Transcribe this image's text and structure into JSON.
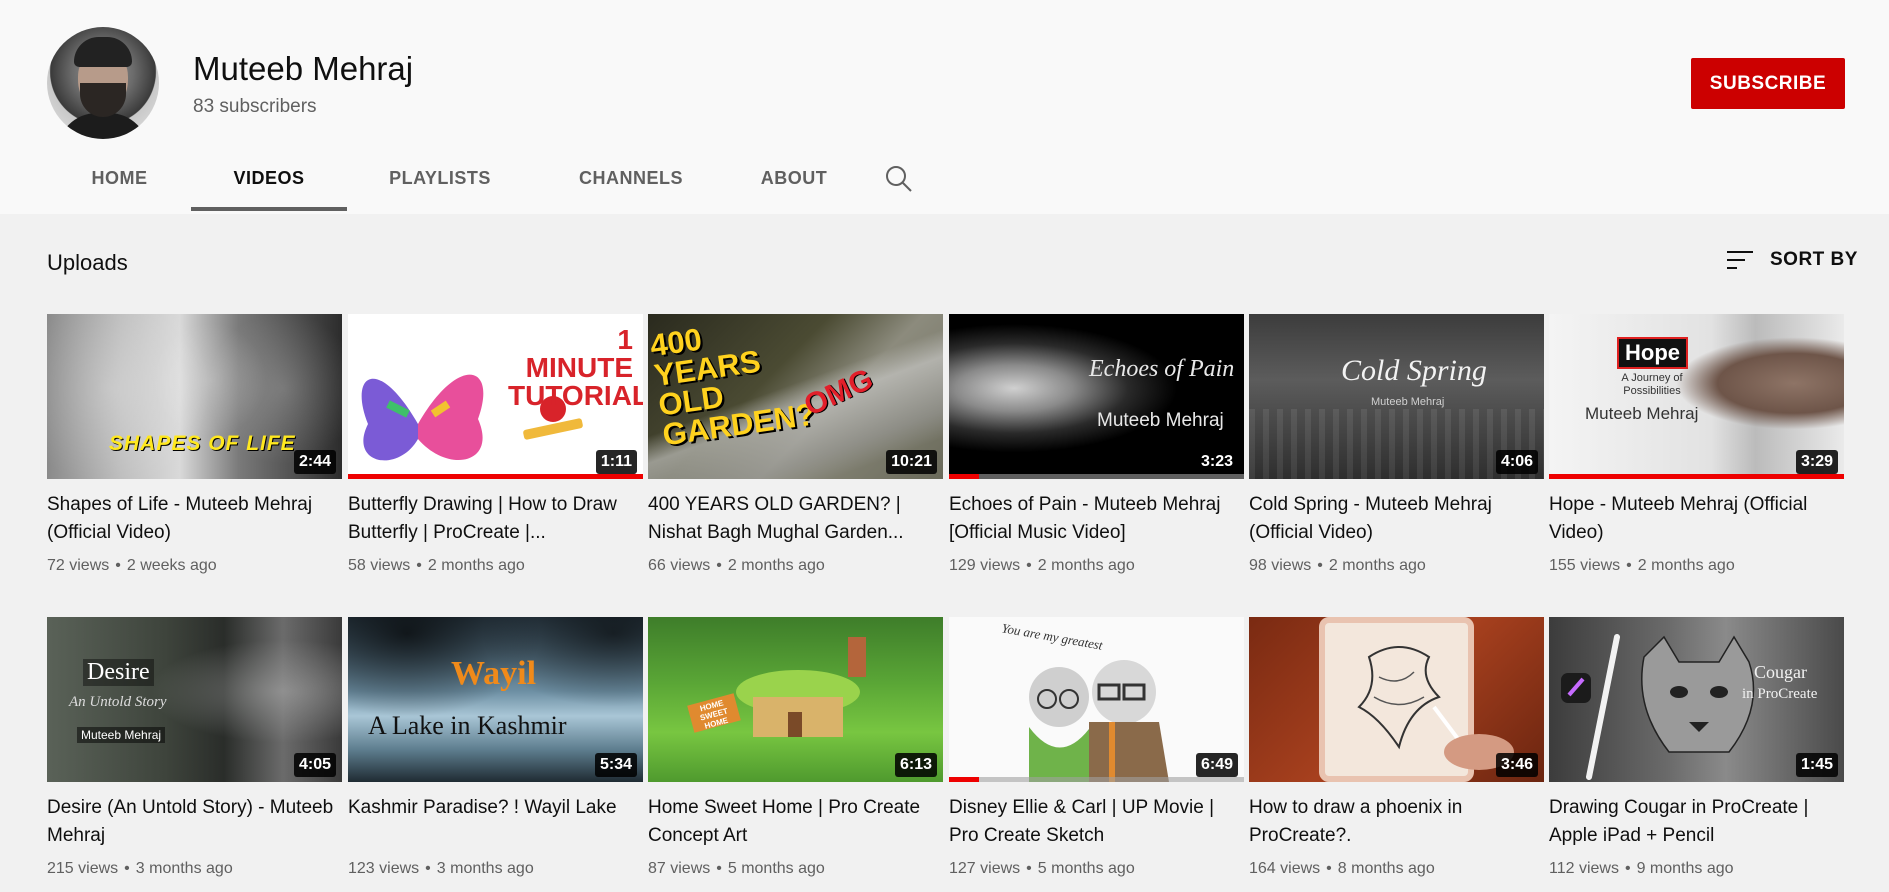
{
  "channel": {
    "name": "Muteeb Mehraj",
    "subscribers": "83 subscribers",
    "subscribe_label": "SUBSCRIBE"
  },
  "tabs": [
    {
      "label": "HOME"
    },
    {
      "label": "VIDEOS",
      "active": true
    },
    {
      "label": "PLAYLISTS"
    },
    {
      "label": "CHANNELS"
    },
    {
      "label": "ABOUT"
    }
  ],
  "search_icon": "search-icon",
  "section": {
    "title": "Uploads",
    "sort_label": "SORT BY",
    "sort_icon": "sort-icon"
  },
  "videos": [
    {
      "title": "Shapes of Life - Muteeb Mehraj (Official Video)",
      "views": "72 views",
      "age": "2 weeks ago",
      "duration": "2:44",
      "thumb_text": "SHAPES OF LIFE"
    },
    {
      "title": "Butterfly Drawing | How to Draw Butterfly | ProCreate |...",
      "views": "58 views",
      "age": "2 months ago",
      "duration": "1:11",
      "thumb_text": "1 MINUTE TUTORIAL",
      "progress": 1.0
    },
    {
      "title": "400 YEARS OLD GARDEN? | Nishat Bagh Mughal Garden...",
      "views": "66 views",
      "age": "2 months ago",
      "duration": "10:21",
      "thumb_text": "400 YEARS OLD GARDEN?",
      "thumb_text2": "OMG"
    },
    {
      "title": "Echoes of Pain - Muteeb Mehraj [Official Music Video]",
      "views": "129 views",
      "age": "2 months ago",
      "duration": "3:23",
      "thumb_text": "Echoes of Pain",
      "thumb_text2": "Muteeb Mehraj",
      "progress": 0.1
    },
    {
      "title": "Cold Spring - Muteeb Mehraj (Official Video)",
      "views": "98 views",
      "age": "2 months ago",
      "duration": "4:06",
      "thumb_text": "Cold Spring",
      "thumb_text2": "Muteeb Mehraj"
    },
    {
      "title": "Hope - Muteeb Mehraj (Official Video)",
      "views": "155 views",
      "age": "2 months ago",
      "duration": "3:29",
      "thumb_text": "Hope",
      "thumb_text2": "A Journey of Possibilities",
      "thumb_text3": "Muteeb Mehraj",
      "progress": 1.0
    },
    {
      "title": "Desire (An Untold Story) - Muteeb Mehraj",
      "views": "215 views",
      "age": "3 months ago",
      "duration": "4:05",
      "thumb_text": "Desire",
      "thumb_text2": "An Untold Story",
      "thumb_text3": "Muteeb Mehraj"
    },
    {
      "title": "Kashmir Paradise? ! Wayil Lake",
      "views": "123 views",
      "age": "3 months ago",
      "duration": "5:34",
      "thumb_text": "Wayil",
      "thumb_text2": "A Lake in Kashmir"
    },
    {
      "title": "Home Sweet Home | Pro Create Concept Art",
      "views": "87 views",
      "age": "5 months ago",
      "duration": "6:13",
      "thumb_text": "HOME SWEET HOME"
    },
    {
      "title": "Disney Ellie & Carl | UP Movie | Pro Create Sketch",
      "views": "127 views",
      "age": "5 months ago",
      "duration": "6:49",
      "thumb_text": "You are my greatest",
      "progress": 0.1
    },
    {
      "title": "How to draw a phoenix in ProCreate?.",
      "views": "164 views",
      "age": "8 months ago",
      "duration": "3:46"
    },
    {
      "title": "Drawing Cougar in ProCreate | Apple iPad + Pencil",
      "views": "112 views",
      "age": "9 months ago",
      "duration": "1:45",
      "thumb_text": "Cougar",
      "thumb_text2": "in ProCreate"
    }
  ],
  "colors": {
    "subscribe": "#cc0000",
    "progress": "#ee0000",
    "header_bg": "#f9f9f9",
    "page_bg": "#f1f1f1"
  }
}
